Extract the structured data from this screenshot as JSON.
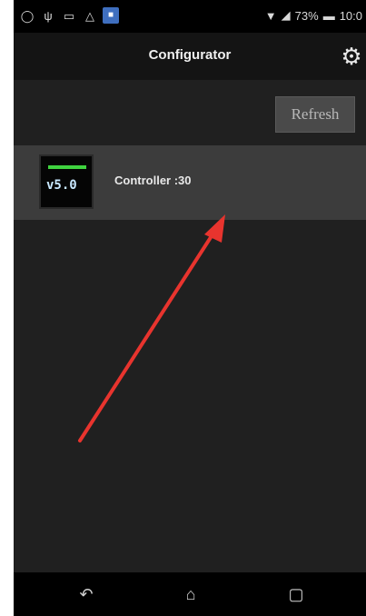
{
  "status_bar": {
    "icons": [
      "whatsapp-icon",
      "usb-icon",
      "image-icon",
      "warning-icon",
      "app-icon"
    ],
    "battery_percent": "73%",
    "time": "10:0",
    "signal": "wifi-and-cellular-icon"
  },
  "appbar": {
    "title": "Configurator",
    "settings_icon": "gear-icon"
  },
  "toolbar": {
    "refresh_label": "Refresh"
  },
  "devices": [
    {
      "label": "Controller :30",
      "thumbnail_readout": "v5.0",
      "thumbnail_icon": "controller-device-icon"
    }
  ],
  "navbar": {
    "back_icon": "back-icon",
    "home_icon": "home-icon",
    "recents_icon": "recents-icon"
  },
  "annotation": {
    "arrow_color": "#e8342e"
  },
  "colors": {
    "background": "#202020",
    "status_bar": "#000000",
    "appbar": "#141414",
    "device_row": "#3c3c3c",
    "refresh_button": "#4a4a4a"
  }
}
